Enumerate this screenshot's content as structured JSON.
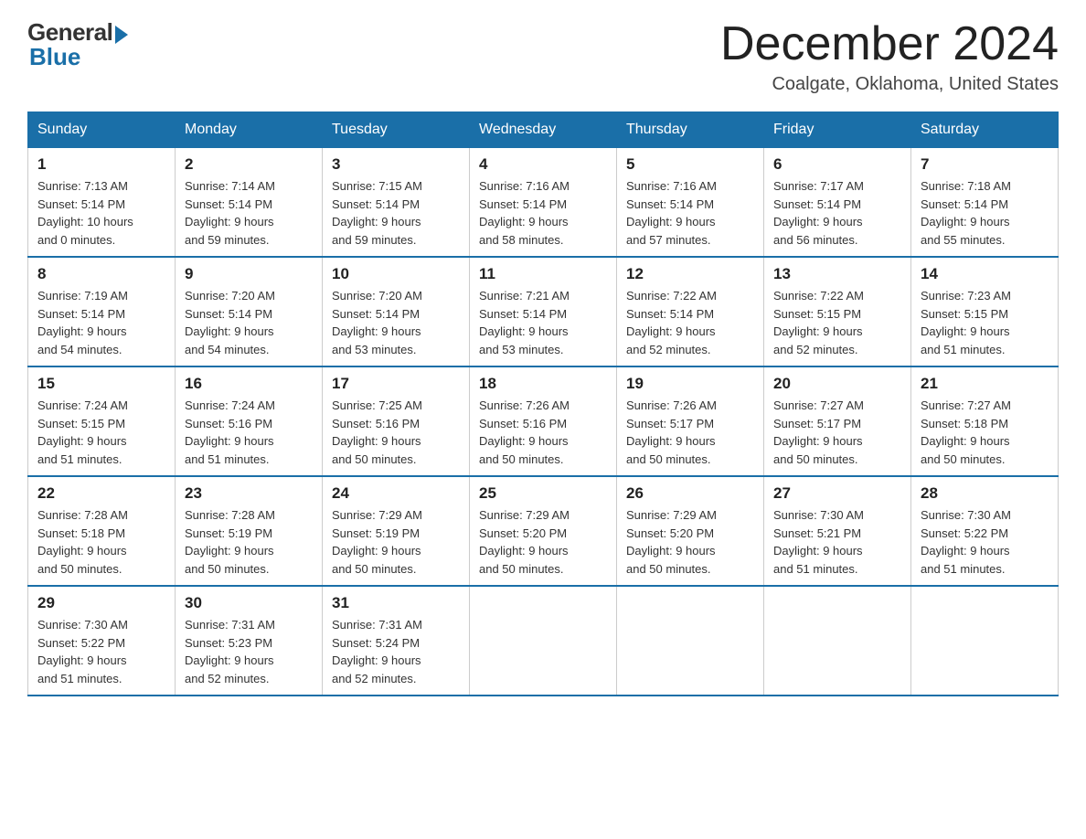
{
  "logo": {
    "general": "General",
    "blue": "Blue"
  },
  "title": "December 2024",
  "location": "Coalgate, Oklahoma, United States",
  "days_of_week": [
    "Sunday",
    "Monday",
    "Tuesday",
    "Wednesday",
    "Thursday",
    "Friday",
    "Saturday"
  ],
  "weeks": [
    [
      {
        "day": "1",
        "sunrise": "7:13 AM",
        "sunset": "5:14 PM",
        "daylight": "10 hours and 0 minutes."
      },
      {
        "day": "2",
        "sunrise": "7:14 AM",
        "sunset": "5:14 PM",
        "daylight": "9 hours and 59 minutes."
      },
      {
        "day": "3",
        "sunrise": "7:15 AM",
        "sunset": "5:14 PM",
        "daylight": "9 hours and 59 minutes."
      },
      {
        "day": "4",
        "sunrise": "7:16 AM",
        "sunset": "5:14 PM",
        "daylight": "9 hours and 58 minutes."
      },
      {
        "day": "5",
        "sunrise": "7:16 AM",
        "sunset": "5:14 PM",
        "daylight": "9 hours and 57 minutes."
      },
      {
        "day": "6",
        "sunrise": "7:17 AM",
        "sunset": "5:14 PM",
        "daylight": "9 hours and 56 minutes."
      },
      {
        "day": "7",
        "sunrise": "7:18 AM",
        "sunset": "5:14 PM",
        "daylight": "9 hours and 55 minutes."
      }
    ],
    [
      {
        "day": "8",
        "sunrise": "7:19 AM",
        "sunset": "5:14 PM",
        "daylight": "9 hours and 54 minutes."
      },
      {
        "day": "9",
        "sunrise": "7:20 AM",
        "sunset": "5:14 PM",
        "daylight": "9 hours and 54 minutes."
      },
      {
        "day": "10",
        "sunrise": "7:20 AM",
        "sunset": "5:14 PM",
        "daylight": "9 hours and 53 minutes."
      },
      {
        "day": "11",
        "sunrise": "7:21 AM",
        "sunset": "5:14 PM",
        "daylight": "9 hours and 53 minutes."
      },
      {
        "day": "12",
        "sunrise": "7:22 AM",
        "sunset": "5:14 PM",
        "daylight": "9 hours and 52 minutes."
      },
      {
        "day": "13",
        "sunrise": "7:22 AM",
        "sunset": "5:15 PM",
        "daylight": "9 hours and 52 minutes."
      },
      {
        "day": "14",
        "sunrise": "7:23 AM",
        "sunset": "5:15 PM",
        "daylight": "9 hours and 51 minutes."
      }
    ],
    [
      {
        "day": "15",
        "sunrise": "7:24 AM",
        "sunset": "5:15 PM",
        "daylight": "9 hours and 51 minutes."
      },
      {
        "day": "16",
        "sunrise": "7:24 AM",
        "sunset": "5:16 PM",
        "daylight": "9 hours and 51 minutes."
      },
      {
        "day": "17",
        "sunrise": "7:25 AM",
        "sunset": "5:16 PM",
        "daylight": "9 hours and 50 minutes."
      },
      {
        "day": "18",
        "sunrise": "7:26 AM",
        "sunset": "5:16 PM",
        "daylight": "9 hours and 50 minutes."
      },
      {
        "day": "19",
        "sunrise": "7:26 AM",
        "sunset": "5:17 PM",
        "daylight": "9 hours and 50 minutes."
      },
      {
        "day": "20",
        "sunrise": "7:27 AM",
        "sunset": "5:17 PM",
        "daylight": "9 hours and 50 minutes."
      },
      {
        "day": "21",
        "sunrise": "7:27 AM",
        "sunset": "5:18 PM",
        "daylight": "9 hours and 50 minutes."
      }
    ],
    [
      {
        "day": "22",
        "sunrise": "7:28 AM",
        "sunset": "5:18 PM",
        "daylight": "9 hours and 50 minutes."
      },
      {
        "day": "23",
        "sunrise": "7:28 AM",
        "sunset": "5:19 PM",
        "daylight": "9 hours and 50 minutes."
      },
      {
        "day": "24",
        "sunrise": "7:29 AM",
        "sunset": "5:19 PM",
        "daylight": "9 hours and 50 minutes."
      },
      {
        "day": "25",
        "sunrise": "7:29 AM",
        "sunset": "5:20 PM",
        "daylight": "9 hours and 50 minutes."
      },
      {
        "day": "26",
        "sunrise": "7:29 AM",
        "sunset": "5:20 PM",
        "daylight": "9 hours and 50 minutes."
      },
      {
        "day": "27",
        "sunrise": "7:30 AM",
        "sunset": "5:21 PM",
        "daylight": "9 hours and 51 minutes."
      },
      {
        "day": "28",
        "sunrise": "7:30 AM",
        "sunset": "5:22 PM",
        "daylight": "9 hours and 51 minutes."
      }
    ],
    [
      {
        "day": "29",
        "sunrise": "7:30 AM",
        "sunset": "5:22 PM",
        "daylight": "9 hours and 51 minutes."
      },
      {
        "day": "30",
        "sunrise": "7:31 AM",
        "sunset": "5:23 PM",
        "daylight": "9 hours and 52 minutes."
      },
      {
        "day": "31",
        "sunrise": "7:31 AM",
        "sunset": "5:24 PM",
        "daylight": "9 hours and 52 minutes."
      },
      null,
      null,
      null,
      null
    ]
  ],
  "labels": {
    "sunrise": "Sunrise:",
    "sunset": "Sunset:",
    "daylight": "Daylight:"
  }
}
